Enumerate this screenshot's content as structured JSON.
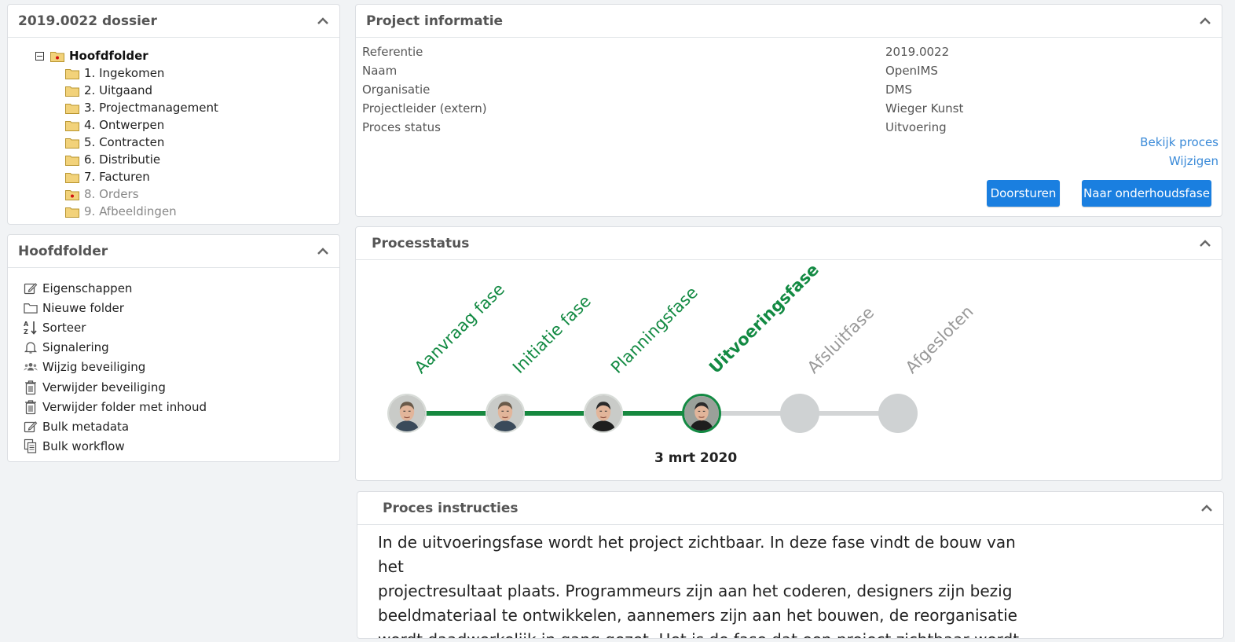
{
  "dossier": {
    "title": "2019.0022 dossier",
    "root": "Hoofdfolder",
    "folders": [
      {
        "label": "1. Ingekomen",
        "muted": false,
        "flag": false
      },
      {
        "label": "2. Uitgaand",
        "muted": false,
        "flag": false
      },
      {
        "label": "3. Projectmanagement",
        "muted": false,
        "flag": false
      },
      {
        "label": "4. Ontwerpen",
        "muted": false,
        "flag": false
      },
      {
        "label": "5. Contracten",
        "muted": false,
        "flag": false
      },
      {
        "label": "6. Distributie",
        "muted": false,
        "flag": false
      },
      {
        "label": "7. Facturen",
        "muted": false,
        "flag": false
      },
      {
        "label": "8. Orders",
        "muted": true,
        "flag": true
      },
      {
        "label": "9. Afbeeldingen",
        "muted": true,
        "flag": false
      }
    ]
  },
  "hoofdfolder": {
    "title": "Hoofdfolder",
    "actions": [
      {
        "label": "Eigenschappen",
        "icon": "edit-icon"
      },
      {
        "label": "Nieuwe folder",
        "icon": "folder-outline-icon"
      },
      {
        "label": "Sorteer",
        "icon": "sort-icon"
      },
      {
        "label": "Signalering",
        "icon": "bell-icon"
      },
      {
        "label": "Wijzig beveiliging",
        "icon": "users-icon"
      },
      {
        "label": "Verwijder beveiliging",
        "icon": "trash-icon"
      },
      {
        "label": "Verwijder folder met inhoud",
        "icon": "trash-icon"
      },
      {
        "label": "Bulk metadata",
        "icon": "edit-icon"
      },
      {
        "label": "Bulk workflow",
        "icon": "copy-icon"
      }
    ]
  },
  "project": {
    "title": "Project informatie",
    "rows": [
      {
        "label": "Referentie",
        "value": "2019.0022"
      },
      {
        "label": "Naam",
        "value": "OpenIMS"
      },
      {
        "label": "Organisatie",
        "value": "DMS"
      },
      {
        "label": "Projectleider (extern)",
        "value": "Wieger Kunst"
      },
      {
        "label": "Proces status",
        "value": "Uitvoering"
      }
    ],
    "link_view": "Bekijk proces",
    "link_edit": "Wijzigen",
    "btn_forward": "Doorsturen",
    "btn_maintenance": "Naar onderhoudsfase"
  },
  "process": {
    "title": "Processtatus",
    "phases": [
      {
        "label": "Aanvraag fase",
        "state": "done"
      },
      {
        "label": "Initiatie fase",
        "state": "done"
      },
      {
        "label": "Planningsfase",
        "state": "done"
      },
      {
        "label": "Uitvoeringsfase",
        "state": "current"
      },
      {
        "label": "Afsluitfase",
        "state": "todo"
      },
      {
        "label": "Afgesloten",
        "state": "todo"
      }
    ],
    "current_date": "3 mrt 2020",
    "colors": {
      "done": "#138a43",
      "todo": "#999999",
      "track_done": "#16883f",
      "track_todo": "#d3d5d6"
    }
  },
  "instructions": {
    "title": "Proces instructies",
    "lines": [
      "In de uitvoeringsfase wordt het project zichtbaar. In deze fase vindt de bouw van het",
      "projectresultaat plaats. Programmeurs zijn aan het coderen, designers zijn bezig",
      "beeldmateriaal te ontwikkelen, aannemers zijn aan het bouwen, de reorganisatie",
      "wordt daadwerkelijk in gang gezet. Het is de fase dat een project zichtbaar wordt"
    ]
  }
}
